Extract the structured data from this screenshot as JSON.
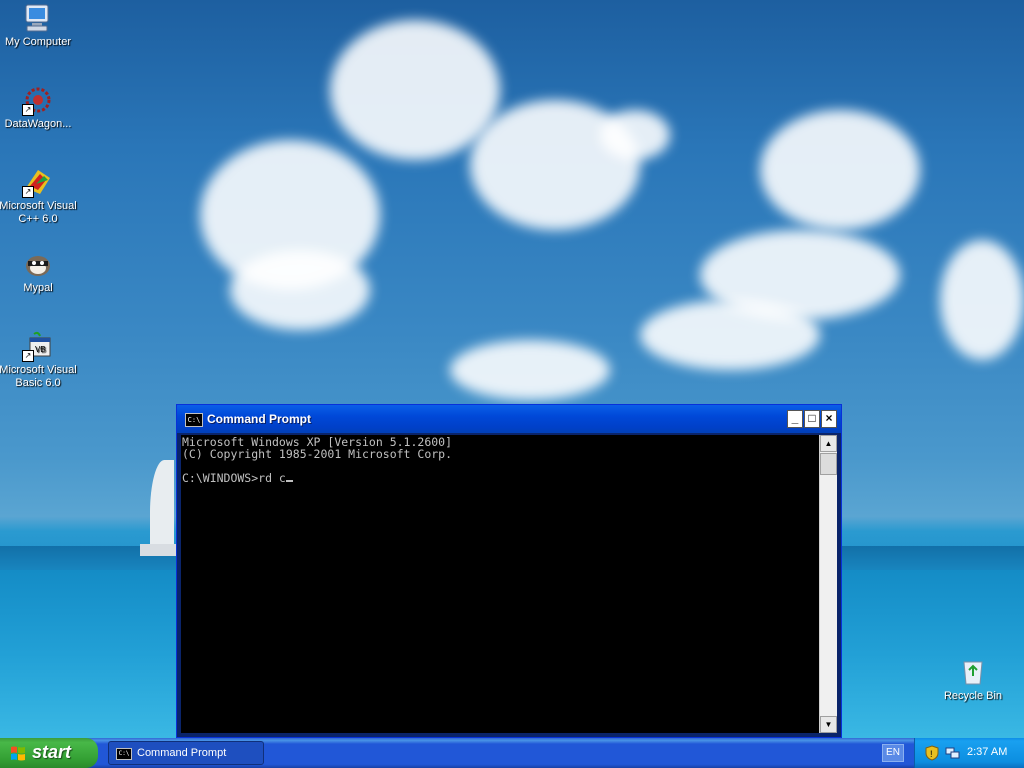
{
  "desktop": {
    "icons": [
      {
        "label": "My Computer"
      },
      {
        "label": "DataWagon..."
      },
      {
        "label": "Microsoft Visual C++ 6.0"
      },
      {
        "label": "Mypal"
      },
      {
        "label": "Microsoft Visual Basic 6.0"
      },
      {
        "label": "Recycle Bin"
      }
    ]
  },
  "cmd_window": {
    "title": "Command Prompt",
    "icon_text": "C:\\",
    "minimize_label": "_",
    "maximize_label": "□",
    "close_label": "×",
    "lines": [
      "Microsoft Windows XP [Version 5.1.2600]",
      "(C) Copyright 1985-2001 Microsoft Corp.",
      "",
      "C:\\WINDOWS>rd c"
    ],
    "scroll_up": "▲",
    "scroll_down": "▼"
  },
  "taskbar": {
    "start_label": "start",
    "tasks": [
      {
        "label": "Command Prompt",
        "icon_text": "C:\\"
      }
    ],
    "language": "EN",
    "clock": "2:37 AM"
  },
  "colors": {
    "taskbar_blue": "#2157d7",
    "start_green": "#34a034",
    "title_blue": "#0048d8",
    "console_bg": "#000000",
    "console_fg": "#c0c0c0"
  }
}
